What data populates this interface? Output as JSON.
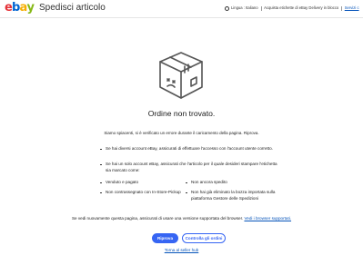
{
  "header": {
    "logo_letters": [
      "e",
      "b",
      "a",
      "y"
    ],
    "logo_colors": [
      "#e53238",
      "#0064d2",
      "#f5af02",
      "#86b817"
    ],
    "page_heading": "Spedisci articolo",
    "language_link": "Lingua : Italiano",
    "delivery_link": "Acquista etichette di eBay Delivery in blocco",
    "truncated_link": "Servizi c"
  },
  "main": {
    "title": "Ordine non trovato.",
    "error_message": "Siamo spiacenti, si è verificato un errore durante il caricamento della pagina. Riprova.",
    "bullets": [
      "Se hai diversi account eBay, assicurati di effettuare l'accesso con l'account utente corretto.",
      "Se hai un solo account eBay, assicurati che l'articolo per il quale desideri stampare l'etichetta sia marcato come:"
    ],
    "sub_items": [
      "Venduto e pagato",
      "Non ancora spedito",
      "Non contrassegnato con In-Store-Pickup",
      "Non hai già eliminato la bozza importata sulla piattaforma Gestore delle Spedizioni"
    ],
    "footer_text": "Se vedi nuovamente questa pagina, assicurati di usare una versione supportata del browser.",
    "footer_link": "Vedi i browser supportati."
  },
  "actions": {
    "retry_label": "Riprova",
    "refresh_label": "Controlla gli ordini",
    "back_link": "Torna al seller hub"
  },
  "colors": {
    "primary": "#3665f3",
    "link": "#0654ba",
    "text": "#191919"
  }
}
